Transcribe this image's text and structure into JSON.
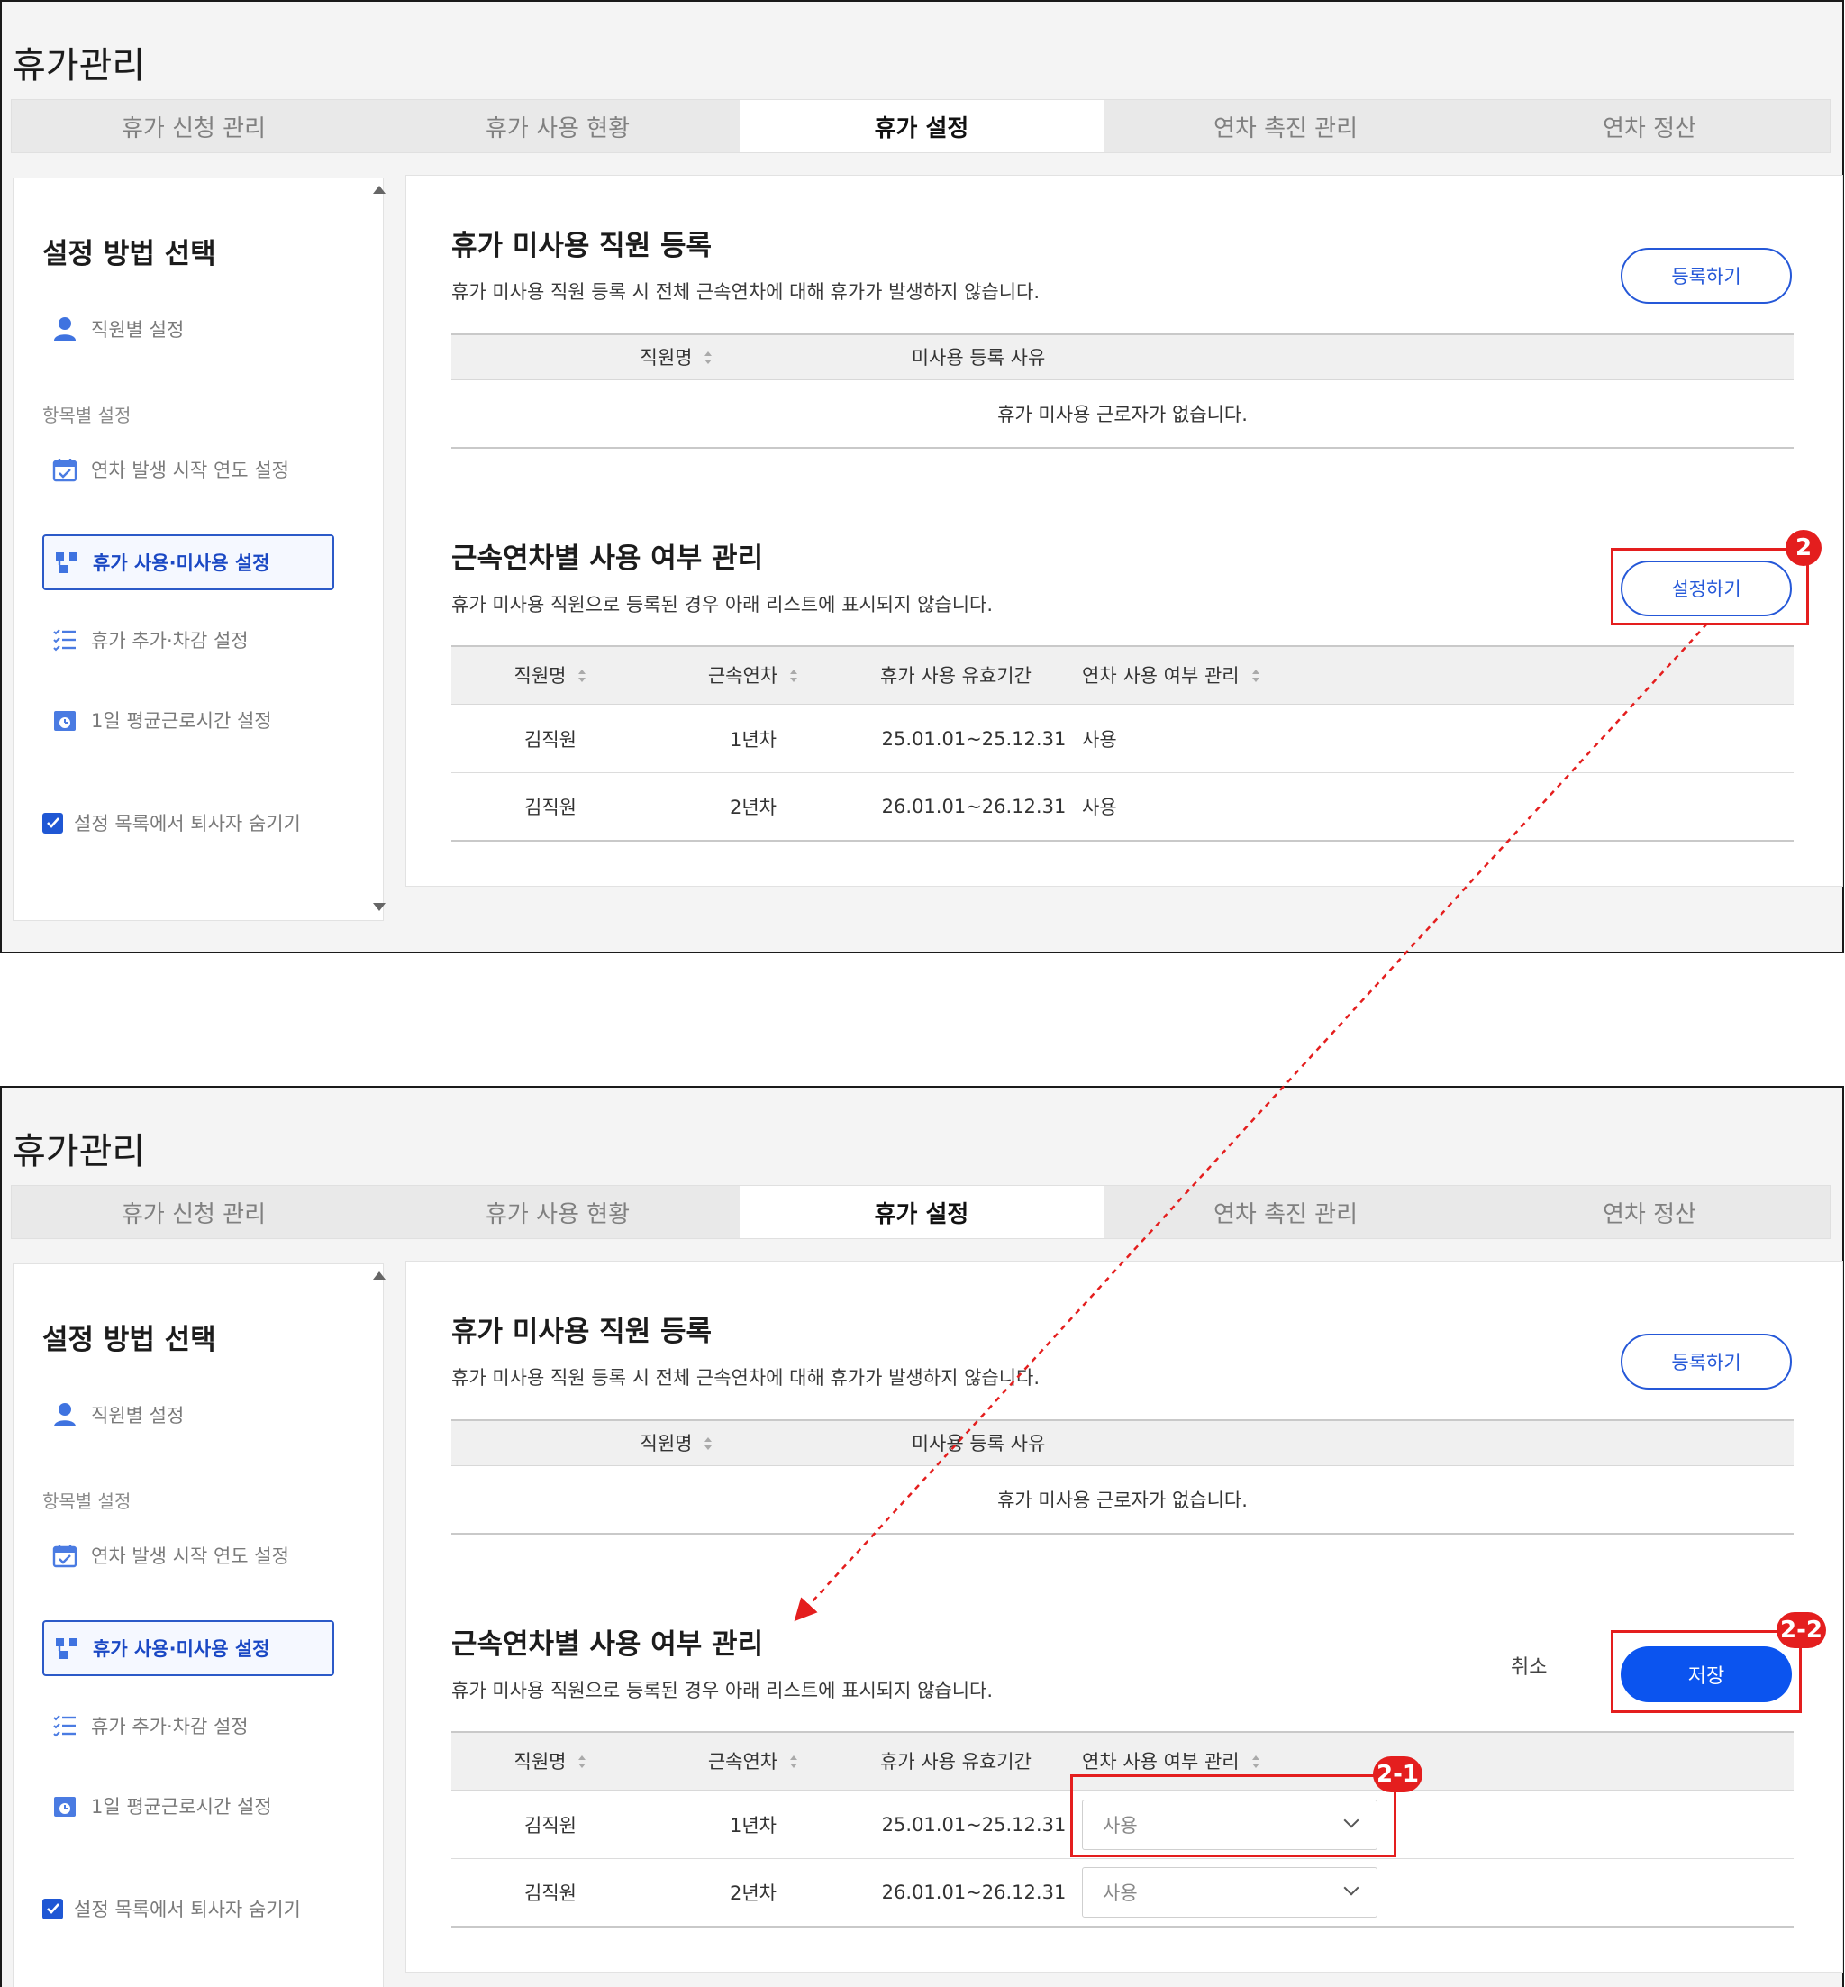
{
  "app": {
    "title": "휴가관리"
  },
  "tabs": [
    {
      "label": "휴가 신청 관리"
    },
    {
      "label": "휴가 사용 현황"
    },
    {
      "label": "휴가 설정"
    },
    {
      "label": "연차 촉진 관리"
    },
    {
      "label": "연차 정산"
    }
  ],
  "sidebar": {
    "title": "설정 방법 선택",
    "employee_setting": "직원별 설정",
    "section_label": "항목별 설정",
    "items": [
      {
        "label": "연차 발생 시작 연도 설정",
        "icon": "calendar-icon"
      },
      {
        "label": "휴가 사용·미사용 설정",
        "icon": "flow-icon"
      },
      {
        "label": "휴가 추가·차감 설정",
        "icon": "checklist-icon"
      },
      {
        "label": "1일 평균근로시간 설정",
        "icon": "clock-calendar-icon"
      }
    ],
    "hide_retired_label": "설정 목록에서 퇴사자 숨기기",
    "hide_retired_checked": true
  },
  "unused_section": {
    "title": "휴가 미사용 직원 등록",
    "description": "휴가 미사용 직원 등록 시 전체 근속연차에 대해 휴가가 발생하지 않습니다.",
    "register_button": "등록하기",
    "columns": [
      "직원명",
      "미사용 등록 사유"
    ],
    "empty_message": "휴가 미사용 근로자가 없습니다."
  },
  "years_section": {
    "title": "근속연차별 사용 여부 관리",
    "description": "휴가 미사용 직원으로 등록된 경우 아래 리스트에 표시되지 않습니다.",
    "set_button": "설정하기",
    "save_button": "저장",
    "cancel_button": "취소",
    "columns": [
      "직원명",
      "근속연차",
      "휴가 사용 유효기간",
      "연차 사용 여부 관리"
    ],
    "rows": [
      {
        "name": "김직원",
        "year": "1년차",
        "period": "25.01.01~25.12.31",
        "usage": "사용"
      },
      {
        "name": "김직원",
        "year": "2년차",
        "period": "26.01.01~26.12.31",
        "usage": "사용"
      }
    ]
  },
  "annotations": {
    "badge_set": "2",
    "badge_select": "2-1",
    "badge_save": "2-2",
    "highlight_color": "#e41e1e",
    "accent_color": "#0b54ef"
  }
}
